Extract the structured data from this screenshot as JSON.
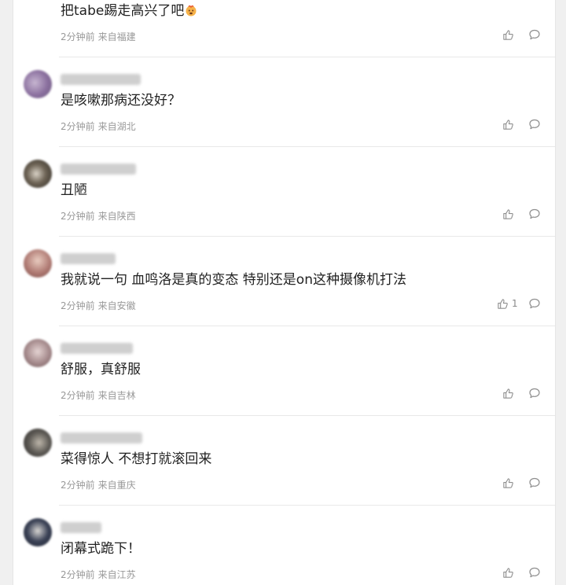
{
  "comments": [
    {
      "avatar_color": "#dddddd",
      "text": "把tabe踢走高兴了吧",
      "time": "2分钟前",
      "location": "来自福建",
      "likes": "",
      "emoji": "hot-face-emoji"
    },
    {
      "avatar_color": "#8a6f9e",
      "text": "是咳嗽那病还没好？",
      "time": "2分钟前",
      "location": "来自湖北",
      "likes": ""
    },
    {
      "avatar_color": "#4a4035",
      "text": "丑陋",
      "time": "2分钟前",
      "location": "来自陕西",
      "likes": ""
    },
    {
      "avatar_color": "#b07b74",
      "text": "我就说一句 血鸣洛是真的变态 特别还是on这种摄像机打法",
      "time": "2分钟前",
      "location": "来自安徽",
      "likes": "1"
    },
    {
      "avatar_color": "#a58a8c",
      "text": "舒服，真舒服",
      "time": "2分钟前",
      "location": "来自吉林",
      "likes": ""
    },
    {
      "avatar_color": "#5d5a55",
      "text": "菜得惊人 不想打就滚回来",
      "time": "2分钟前",
      "location": "来自重庆",
      "likes": ""
    },
    {
      "avatar_color": "#3b4256",
      "text": "闭幕式跪下！",
      "time": "2分钟前",
      "location": "来自江苏",
      "likes": ""
    }
  ],
  "icons": {
    "like": "thumbs-up-icon",
    "reply": "comment-bubble-icon"
  }
}
